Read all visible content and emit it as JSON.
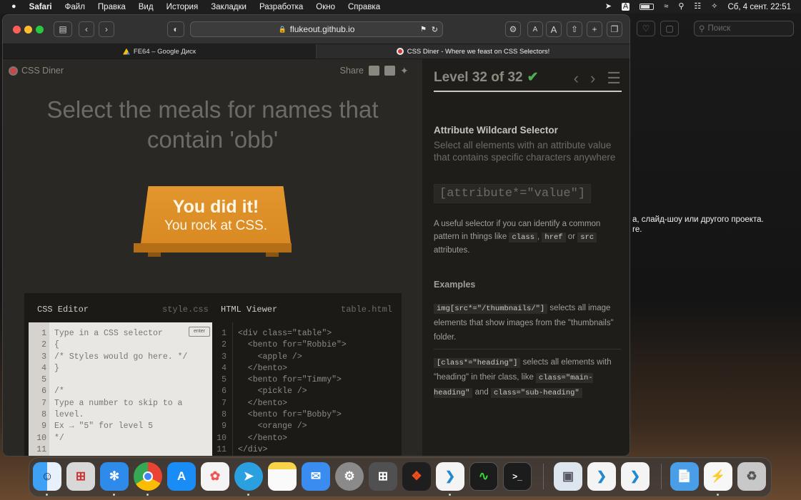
{
  "menubar": {
    "apple": "",
    "app": "Safari",
    "items": [
      "Файл",
      "Правка",
      "Вид",
      "История",
      "Закладки",
      "Разработка",
      "Окно",
      "Справка"
    ],
    "datetime": "Сб, 4 сент.  22:51",
    "status_a": "A"
  },
  "background_doc": {
    "line1": "а, слайд-шоу или другого проекта.",
    "line2": "re."
  },
  "safari": {
    "url": "flukeout.github.io",
    "search_placeholder": "Поиск",
    "font_small": "A",
    "font_large": "A",
    "tabs": [
      {
        "title": "FE64 – Google Диск"
      },
      {
        "title": "CSS Diner - Where we feast on CSS Selectors!"
      }
    ]
  },
  "game": {
    "logo": "CSS Diner",
    "share": "Share",
    "instruction": "Select the meals for names that contain 'obb'",
    "success_title": "You did it!",
    "success_sub": "You rock at CSS.",
    "css_editor_label": "CSS Editor",
    "css_file": "style.css",
    "html_viewer_label": "HTML Viewer",
    "html_file": "table.html",
    "enter_label": "enter",
    "css_lines": [
      "Type in a CSS selector",
      "{",
      "/* Styles would go here. */",
      "}",
      "",
      "/*",
      "Type a number to skip to a",
      "level.",
      "Ex → \"5\" for level 5",
      "*/",
      ""
    ],
    "html_lines": [
      "<div class=\"table\">",
      "  <bento for=\"Robbie\">",
      "    <apple />",
      "  </bento>",
      "  <bento for=\"Timmy\">",
      "    <pickle />",
      "  </bento>",
      "  <bento for=\"Bobby\">",
      "    <orange />",
      "  </bento>",
      "</div>"
    ],
    "line_numbers": [
      "1",
      "2",
      "3",
      "4",
      "5",
      "6",
      "7",
      "8",
      "9",
      "10",
      "11"
    ]
  },
  "level": {
    "label": "Level 32 of 32",
    "check": "✔",
    "prev": "‹",
    "next": "›",
    "menu": "☰",
    "progress": 1.0
  },
  "help": {
    "title": "Attribute Wildcard Selector",
    "description": "Select all elements with an attribute value that contains specific characters anywhere",
    "syntax": "[attribute*=\"value\"]",
    "text_before": "A useful selector if you can identify a common pattern in things like ",
    "chip_class": "class",
    "sep1": ", ",
    "chip_href": "href",
    "or": " or ",
    "chip_src": "src",
    "text_after": " attributes.",
    "examples_title": "Examples",
    "ex1_code": "img[src*=\"/thumbnails/\"]",
    "ex1_text": " selects all image elements that show images from the \"thumbnails\" folder.",
    "ex2_code": "[class*=\"heading\"]",
    "ex2_text": " selects all elements with \"heading\" in their class, like ",
    "ex2_chip1": "class=\"main-heading\"",
    "ex2_and": " and ",
    "ex2_chip2": "class=\"sub-heading\""
  },
  "dock": {
    "items": [
      "finder",
      "launchpad",
      "safari",
      "chrome",
      "app-store",
      "photos",
      "telegram",
      "notes",
      "mail",
      "system-preferences",
      "calculator",
      "figma",
      "vscode",
      "activity-monitor",
      "terminal",
      "preview",
      "vscode-2",
      "vscode-3",
      "files",
      "sublime",
      "trash"
    ]
  }
}
